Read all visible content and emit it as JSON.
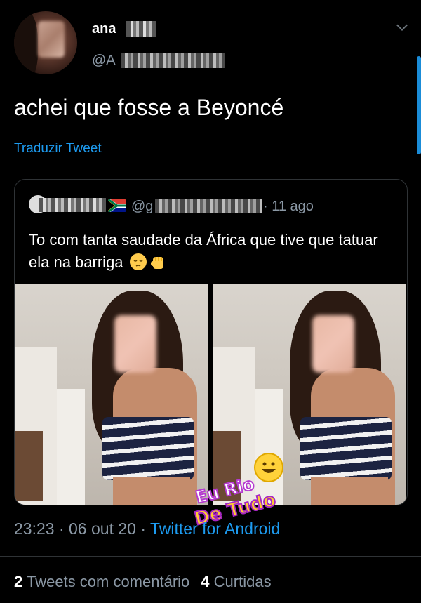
{
  "author": {
    "display_name": "ana",
    "handle": "@A"
  },
  "tweet": {
    "text": "achei que fosse a Beyoncé",
    "translate_label": "Traduzir Tweet"
  },
  "quoted": {
    "handle": "@g",
    "time": "· 11 ago",
    "text": "To com tanta saudade da África que tive que tatuar ela na barriga"
  },
  "watermark": {
    "line1": "Eu Rio",
    "line2": "De Tudo"
  },
  "meta": {
    "time": "23:23",
    "sep1": " · ",
    "date": "06 out 20",
    "sep2": " · ",
    "source": "Twitter for Android"
  },
  "stats": {
    "retweets_count": "2",
    "retweets_label": "Tweets com comentário",
    "likes_count": "4",
    "likes_label": "Curtidas"
  },
  "colors": {
    "background": "#000000",
    "accent": "#1d9bf0",
    "secondary_text": "#8b98a5"
  },
  "icons": {
    "more": "chevron-down-icon",
    "emoji1": "pensive-face-icon",
    "emoji2": "raised-fist-icon",
    "flag": "south-africa-flag-icon"
  }
}
